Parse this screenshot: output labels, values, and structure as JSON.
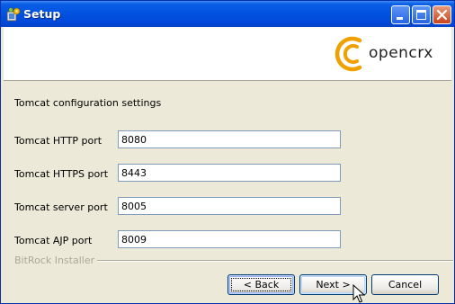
{
  "window": {
    "title": "Setup"
  },
  "header": {
    "logo_text": "opencrx",
    "logo_color": "#f0a000"
  },
  "form": {
    "section_title": "Tomcat configuration settings",
    "fields": [
      {
        "label": "Tomcat HTTP port",
        "value": "8080"
      },
      {
        "label": "Tomcat HTTPS port",
        "value": "8443"
      },
      {
        "label": "Tomcat server port",
        "value": "8005"
      },
      {
        "label": "Tomcat AJP port",
        "value": "8009"
      }
    ]
  },
  "footer": {
    "installer_label": "BitRock Installer"
  },
  "buttons": {
    "back": "< Back",
    "next": "Next >",
    "cancel": "Cancel"
  }
}
